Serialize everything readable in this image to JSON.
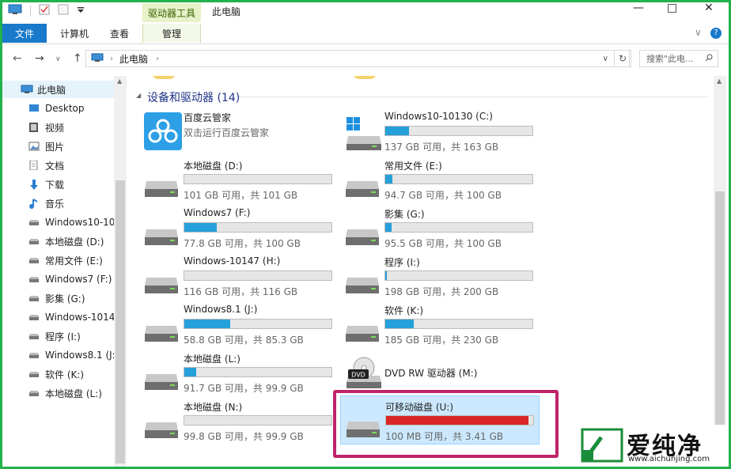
{
  "titlebar": {
    "context_tab": "驱动器工具",
    "title": "此电脑",
    "minimize": "—",
    "maximize": "□",
    "close": "✕"
  },
  "ribbon": {
    "tabs": [
      "文件",
      "计算机",
      "查看",
      "管理"
    ],
    "collapse": "∨",
    "help": "?"
  },
  "address": {
    "path_root": "此电脑",
    "search_placeholder": "搜索\"此电..."
  },
  "nav": {
    "items": [
      {
        "label": "此电脑",
        "icon": "pc-icon"
      },
      {
        "label": "Desktop",
        "icon": "desktop-icon"
      },
      {
        "label": "视频",
        "icon": "video-icon"
      },
      {
        "label": "图片",
        "icon": "pictures-icon"
      },
      {
        "label": "文档",
        "icon": "documents-icon"
      },
      {
        "label": "下载",
        "icon": "download-icon"
      },
      {
        "label": "音乐",
        "icon": "music-icon"
      },
      {
        "label": "Windows10-10",
        "icon": "drive-icon"
      },
      {
        "label": "本地磁盘 (D:)",
        "icon": "drive-icon"
      },
      {
        "label": "常用文件 (E:)",
        "icon": "drive-icon"
      },
      {
        "label": "Windows7 (F:)",
        "icon": "drive-icon"
      },
      {
        "label": "影集 (G:)",
        "icon": "drive-icon"
      },
      {
        "label": "Windows-1014",
        "icon": "drive-icon"
      },
      {
        "label": "程序 (I:)",
        "icon": "drive-icon"
      },
      {
        "label": "Windows8.1 (J:",
        "icon": "drive-icon"
      },
      {
        "label": "软件 (K:)",
        "icon": "drive-icon"
      },
      {
        "label": "本地磁盘 (L:)",
        "icon": "drive-icon"
      }
    ]
  },
  "content": {
    "group_title": "设备和驱动器 (14)",
    "tiles": [
      {
        "name": "百度云管家",
        "desc": "双击运行百度云管家",
        "type": "app"
      },
      {
        "name": "Windows10-10130 (C:)",
        "info": "137 GB 可用，共 163 GB",
        "used_fraction": 0.16,
        "type": "windows"
      },
      {
        "name": "本地磁盘 (D:)",
        "info": "101 GB 可用，共 101 GB",
        "used_fraction": 0.0,
        "type": "drive"
      },
      {
        "name": "常用文件 (E:)",
        "info": "94.7 GB 可用，共 100 GB",
        "used_fraction": 0.05,
        "type": "drive"
      },
      {
        "name": "Windows7 (F:)",
        "info": "77.8 GB 可用，共 100 GB",
        "used_fraction": 0.22,
        "type": "drive"
      },
      {
        "name": "影集 (G:)",
        "info": "95.5 GB 可用，共 100 GB",
        "used_fraction": 0.045,
        "type": "drive"
      },
      {
        "name": "Windows-10147 (H:)",
        "info": "116 GB 可用，共 116 GB",
        "used_fraction": 0.0,
        "type": "drive"
      },
      {
        "name": "程序 (I:)",
        "info": "198 GB 可用，共 200 GB",
        "used_fraction": 0.01,
        "type": "drive"
      },
      {
        "name": "Windows8.1 (J:)",
        "info": "58.8 GB 可用，共 85.3 GB",
        "used_fraction": 0.31,
        "type": "drive"
      },
      {
        "name": "软件 (K:)",
        "info": "185 GB 可用，共 230 GB",
        "used_fraction": 0.195,
        "type": "drive"
      },
      {
        "name": "本地磁盘 (L:)",
        "info": "91.7 GB 可用，共 99.9 GB",
        "used_fraction": 0.08,
        "type": "drive"
      },
      {
        "name": "DVD RW 驱动器 (M:)",
        "type": "dvd"
      },
      {
        "name": "本地磁盘 (N:)",
        "info": "99.8 GB 可用，共 99.9 GB",
        "used_fraction": 0.0,
        "type": "drive"
      },
      {
        "name": "可移动磁盘 (U:)",
        "info": "100 MB 可用，共 3.41 GB",
        "used_fraction": 0.97,
        "type": "removable",
        "selected": true
      }
    ]
  },
  "watermark": {
    "brand": "爱纯净",
    "url": "www.aichunjing.com"
  },
  "colors": {
    "accent": "#1979ca",
    "bar_normal": "#26a0da",
    "bar_full": "#da2626",
    "highlight_box": "#c0236a",
    "frame": "#22b14c",
    "context_tab_bg": "#e6f2c8"
  }
}
